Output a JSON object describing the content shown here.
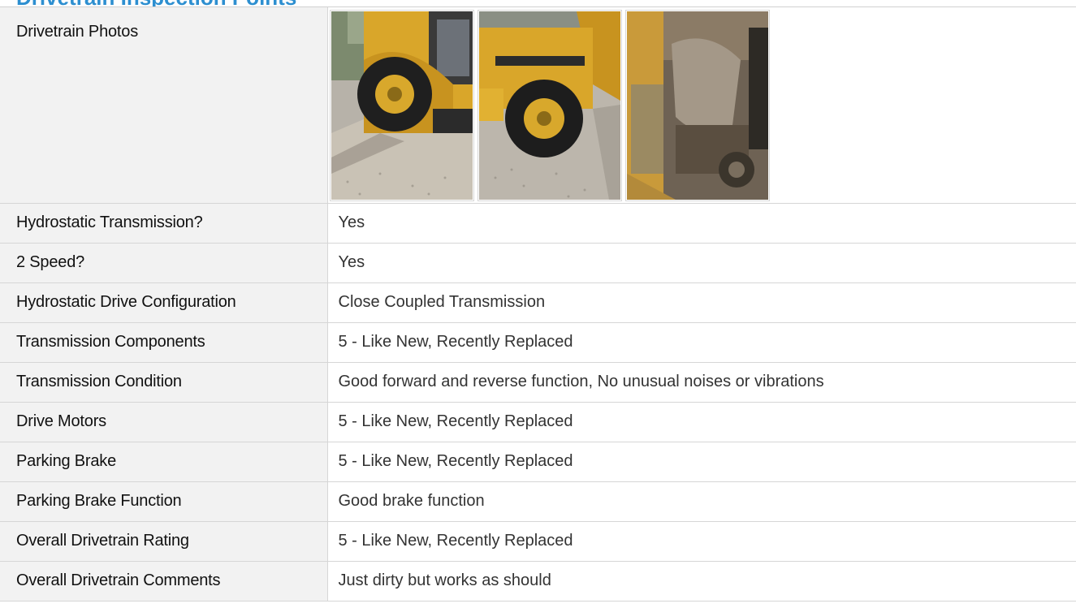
{
  "section": {
    "title": "Drivetrain Inspection Points"
  },
  "photos": {
    "label": "Drivetrain Photos",
    "items": [
      {
        "icon": "backhoe-front-wheel-photo"
      },
      {
        "icon": "backhoe-rear-wheel-photo"
      },
      {
        "icon": "drivetrain-undercarriage-photo"
      }
    ]
  },
  "rows": [
    {
      "label": "Hydrostatic Transmission?",
      "value": "Yes"
    },
    {
      "label": "2 Speed?",
      "value": "Yes"
    },
    {
      "label": "Hydrostatic Drive Configuration",
      "value": "Close Coupled Transmission"
    },
    {
      "label": "Transmission Components",
      "value": "5 - Like New, Recently Replaced"
    },
    {
      "label": "Transmission Condition",
      "value": "Good forward and reverse function, No unusual noises or vibrations"
    },
    {
      "label": "Drive Motors",
      "value": "5 - Like New, Recently Replaced"
    },
    {
      "label": "Parking Brake",
      "value": "5 - Like New, Recently Replaced"
    },
    {
      "label": "Parking Brake Function",
      "value": "Good brake function"
    },
    {
      "label": "Overall Drivetrain Rating",
      "value": "5 - Like New, Recently Replaced"
    },
    {
      "label": "Overall Drivetrain Comments",
      "value": "Just dirty but works as should"
    }
  ],
  "colors": {
    "title": "#2d8fd0",
    "label_bg": "#f2f2f2",
    "border": "#d6d6d6",
    "machine_yellow": "#d9a62a"
  }
}
